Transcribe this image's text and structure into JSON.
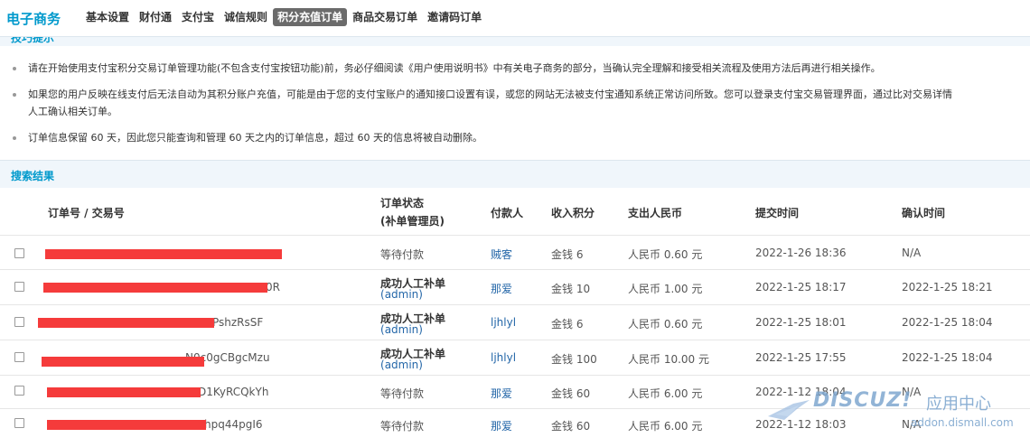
{
  "brand": "电子商务",
  "tabs": [
    "基本设置",
    "财付通",
    "支付宝",
    "诚信规则",
    "积分充值订单",
    "商品交易订单",
    "邀请码订单"
  ],
  "active_tab": 4,
  "tips": {
    "header": "技巧提示",
    "items": [
      "请在开始使用支付宝积分交易订单管理功能(不包含支付宝按钮功能)前，务必仔细阅读《用户使用说明书》中有关电子商务的部分，当确认完全理解和接受相关流程及使用方法后再进行相关操作。",
      "如果您的用户反映在线支付后无法自动为其积分账户充值，可能是由于您的支付宝账户的通知接口设置有误，或您的网站无法被支付宝通知系统正常访问所致。您可以登录支付宝交易管理界面，通过比对交易详情",
      "人工确认相关订单。",
      "订单信息保留 60 天，因此您只能查询和管理 60 天之内的订单信息，超过 60 天的信息将被自动删除。"
    ]
  },
  "results": {
    "header": "搜索结果",
    "columns": {
      "order": "订单号 / 交易号",
      "status_line1": "订单状态",
      "status_line2": "(补单管理员)",
      "payer": "付款人",
      "income": "收入积分",
      "expense": "支出人民币",
      "submit_time": "提交时间",
      "confirm_time": "确认时间"
    },
    "rows": [
      {
        "order_suffix": "",
        "status": "等待付款",
        "admin": "",
        "payer": "贼客",
        "income": "金钱 6",
        "expense": "人民币 0.60 元",
        "submit": "2022-1-26 18:36",
        "confirm": "N/A"
      },
      {
        "order_suffix": "0R",
        "status": "成功人工补单",
        "admin": "admin",
        "payer": "那爱",
        "income": "金钱 10",
        "expense": "人民币 1.00 元",
        "submit": "2022-1-25 18:17",
        "confirm": "2022-1-25 18:21"
      },
      {
        "order_suffix": "PshzRsSF",
        "status": "成功人工补单",
        "admin": "admin",
        "payer": "ljhlyl",
        "income": "金钱 6",
        "expense": "人民币 0.60 元",
        "submit": "2022-1-25 18:01",
        "confirm": "2022-1-25 18:04"
      },
      {
        "order_suffix": "N0c0gCBgcMzu",
        "status": "成功人工补单",
        "admin": "admin",
        "payer": "ljhlyl",
        "income": "金钱 100",
        "expense": "人民币 10.00 元",
        "submit": "2022-1-25 17:55",
        "confirm": "2022-1-25 18:04"
      },
      {
        "order_suffix": "D1KyRCQkYh",
        "status": "等待付款",
        "admin": "",
        "payer": "那爱",
        "income": "金钱 60",
        "expense": "人民币 6.00 元",
        "submit": "2022-1-12 18:04",
        "confirm": "N/A"
      },
      {
        "order_suffix": "hpq44pgI6",
        "status": "等待付款",
        "admin": "",
        "payer": "那爱",
        "income": "金钱 60",
        "expense": "人民币 6.00 元",
        "submit": "2022-1-12 18:03",
        "confirm": "N/A"
      }
    ]
  },
  "watermark": {
    "logo": "DISCUZ!",
    "cn": "应用中心",
    "url": "addon.dismall.com"
  }
}
